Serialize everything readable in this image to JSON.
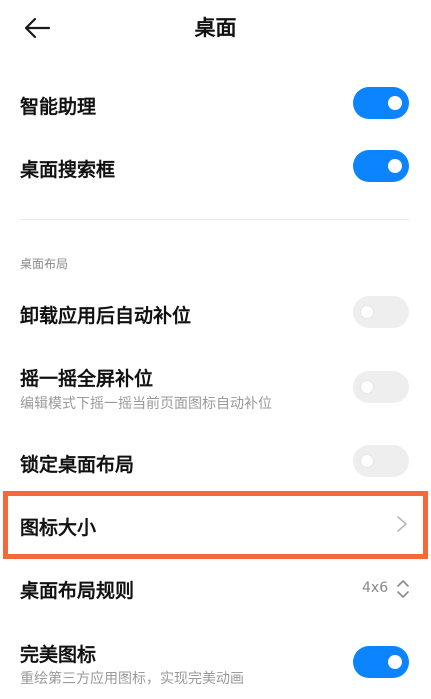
{
  "header": {
    "title": "桌面"
  },
  "settings": {
    "smart_assistant": {
      "label": "智能助理",
      "enabled": true
    },
    "search_box": {
      "label": "桌面搜索框",
      "enabled": true
    },
    "section_label": "桌面布局",
    "auto_fill": {
      "label": "卸载应用后自动补位",
      "enabled": false
    },
    "shake_fill": {
      "label": "摇一摇全屏补位",
      "desc": "编辑模式下摇一摇当前页面图标自动补位",
      "enabled": false
    },
    "lock_layout": {
      "label": "锁定桌面布局",
      "enabled": false
    },
    "icon_size": {
      "label": "图标大小"
    },
    "layout_rule": {
      "label": "桌面布局规则",
      "value": "4x6"
    },
    "perfect_icons": {
      "label": "完美图标",
      "desc": "重绘第三方应用图标，实现完美动画",
      "enabled": true
    }
  },
  "colors": {
    "accent": "#0d84ff",
    "highlight": "#f26a3c",
    "toggle_off": "#eeeeee"
  },
  "icons": {
    "back": "arrow-left-icon",
    "chevron": "chevron-right-icon",
    "updown": "chevron-up-down-icon"
  }
}
